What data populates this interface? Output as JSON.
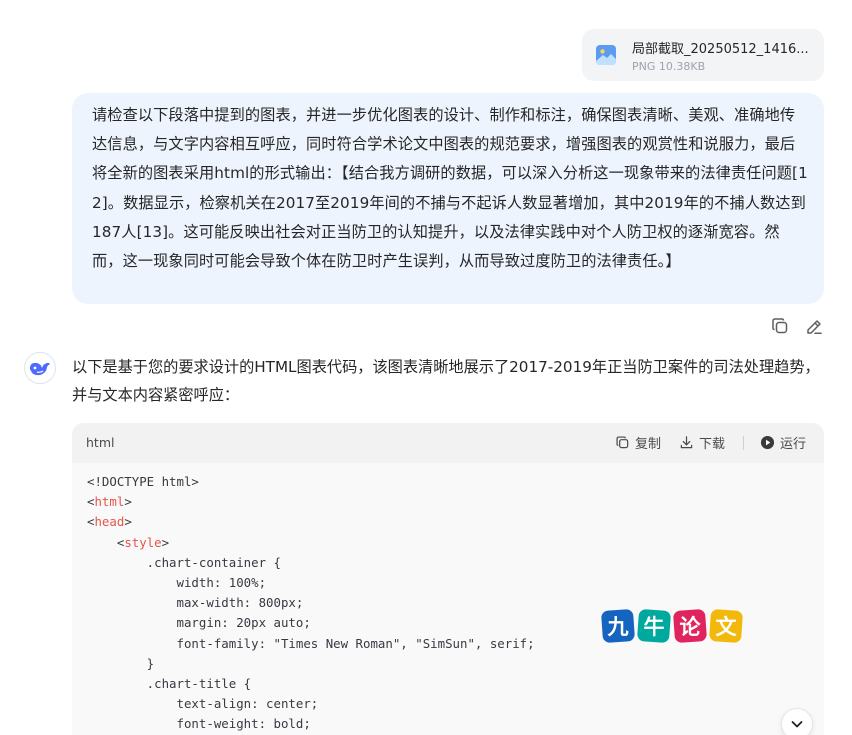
{
  "attachment": {
    "file_name": "局部截取_20250512_1416...",
    "file_meta": "PNG 10.38KB",
    "icon": "image-file-icon"
  },
  "user_message": {
    "text": "请检查以下段落中提到的图表，并进一步优化图表的设计、制作和标注，确保图表清晰、美观、准确地传达信息，与文字内容相互呼应，同时符合学术论文中图表的规范要求，增强图表的观赏性和说服力，最后将全新的图表采用html的形式输出：【结合我方调研的数据，可以深入分析这一现象带来的法律责任问题[12]。数据显示，检察机关在2017至2019年间的不捕与不起诉人数显著增加，其中2019年的不捕人数达到187人[13]。这可能反映出社会对正当防卫的认知提升，以及法律实践中对个人防卫权的逐渐宽容。然而，这一现象同时可能会导致个体在防卫时产生误判，从而导致过度防卫的法律责任。】",
    "actions": {
      "copy_icon": "copy-icon",
      "edit_icon": "edit-icon"
    }
  },
  "assistant_message": {
    "avatar_icon": "whale-logo-icon",
    "text": "以下是基于您的要求设计的HTML图表代码，该图表清晰地展示了2017-2019年正当防卫案件的司法处理趋势，并与文本内容紧密呼应："
  },
  "code_block": {
    "language": "html",
    "copy_label": "复制",
    "download_label": "下载",
    "run_label": "运行",
    "lines": [
      {
        "indent": "",
        "pre": "<!DOCTYPE html>",
        "tag": "",
        "post": ""
      },
      {
        "indent": "",
        "pre": "<",
        "tag": "html",
        "post": ">"
      },
      {
        "indent": "",
        "pre": "<",
        "tag": "head",
        "post": ">"
      },
      {
        "indent": "    ",
        "pre": "<",
        "tag": "style",
        "post": ">"
      },
      {
        "indent": "        ",
        "pre": ".chart-container {",
        "tag": "",
        "post": ""
      },
      {
        "indent": "            ",
        "pre": "width: 100%;",
        "tag": "",
        "post": ""
      },
      {
        "indent": "            ",
        "pre": "max-width: 800px;",
        "tag": "",
        "post": ""
      },
      {
        "indent": "            ",
        "pre": "margin: 20px auto;",
        "tag": "",
        "post": ""
      },
      {
        "indent": "            ",
        "pre": "font-family: \"Times New Roman\", \"SimSun\", serif;",
        "tag": "",
        "post": ""
      },
      {
        "indent": "        ",
        "pre": "}",
        "tag": "",
        "post": ""
      },
      {
        "indent": "        ",
        "pre": ".chart-title {",
        "tag": "",
        "post": ""
      },
      {
        "indent": "            ",
        "pre": "text-align: center;",
        "tag": "",
        "post": ""
      },
      {
        "indent": "            ",
        "pre": "font-weight: bold;",
        "tag": "",
        "post": ""
      }
    ]
  },
  "watermark": {
    "chars": [
      "九",
      "牛",
      "论",
      "文"
    ],
    "colors": [
      "#1565c0",
      "#00a99d",
      "#e0245e",
      "#f2b90c"
    ]
  },
  "scroll_button_icon": "chevron-down-icon",
  "colors": {
    "user_bubble": "#eef4fe",
    "code_tag": "#e45649",
    "code_text": "#383a42"
  }
}
